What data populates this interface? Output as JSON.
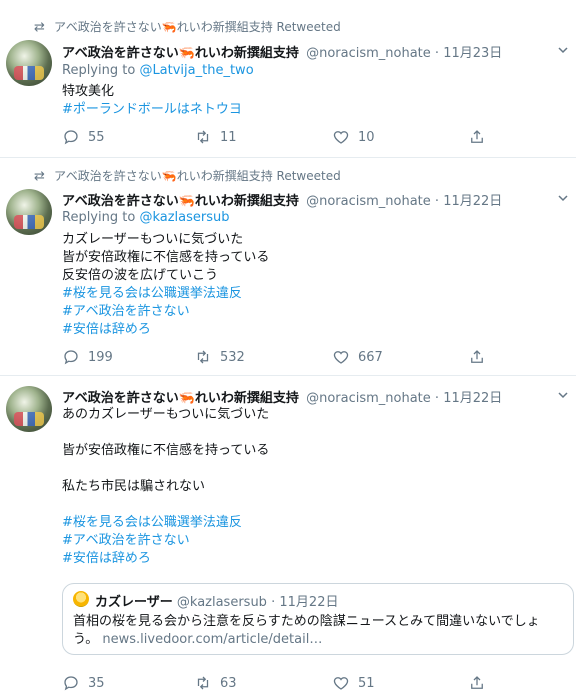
{
  "tweets": [
    {
      "retweet_text": "アベ政治を許さない🦐れいわ新撰組支持 Retweeted",
      "name": "アベ政治を許さない🦐れいわ新撰組支持",
      "handle": "@noracism_nohate",
      "dot": "·",
      "date": "11月23日",
      "reply_prefix": "Replying to ",
      "reply_to": "@Latvija_the_two",
      "text_lines": [
        "特攻美化"
      ],
      "hashtags": [
        "#ポーランドボールはネトウヨ"
      ],
      "replies": "55",
      "retweets": "11",
      "likes": "10"
    },
    {
      "retweet_text": "アベ政治を許さない🦐れいわ新撰組支持 Retweeted",
      "name": "アベ政治を許さない🦐れいわ新撰組支持",
      "handle": "@noracism_nohate",
      "dot": "·",
      "date": "11月22日",
      "reply_prefix": "Replying to ",
      "reply_to": "@kazlasersub",
      "text_lines": [
        "カズレーザーもついに気づいた",
        "皆が安倍政権に不信感を持っている",
        "反安倍の波を広げていこう"
      ],
      "hashtags": [
        "#桜を見る会は公職選挙法違反",
        "#アベ政治を許さない",
        "#安倍は辞めろ"
      ],
      "replies": "199",
      "retweets": "532",
      "likes": "667"
    },
    {
      "name": "アベ政治を許さない🦐れいわ新撰組支持",
      "handle": "@noracism_nohate",
      "dot": "·",
      "date": "11月22日",
      "text_lines": [
        "あのカズレーザーもついに気づいた",
        "皆が安倍政権に不信感を持っている",
        "私たち市民は騙されない"
      ],
      "hashtags": [
        "#桜を見る会は公職選挙法違反",
        "#アベ政治を許さない",
        "#安倍は辞めろ"
      ],
      "quote": {
        "name": "カズレーザー",
        "handle": "@kazlasersub",
        "dot": "·",
        "date": "11月22日",
        "text": "首相の桜を見る会から注意を反らすための陰謀ニュースとみて間違いないでしょう。",
        "link": "news.livedoor.com/article/detail…"
      },
      "replies": "35",
      "retweets": "63",
      "likes": "51"
    }
  ],
  "icons": {
    "retweet_small": "retweet-icon",
    "reply": "reply-icon",
    "retweet": "retweet-icon",
    "like": "heart-icon",
    "share": "share-icon",
    "caret": "chevron-down-icon"
  },
  "colors": {
    "link": "#1b95e0",
    "muted": "#657786",
    "text": "#14171a",
    "border": "#e6ecf0"
  }
}
